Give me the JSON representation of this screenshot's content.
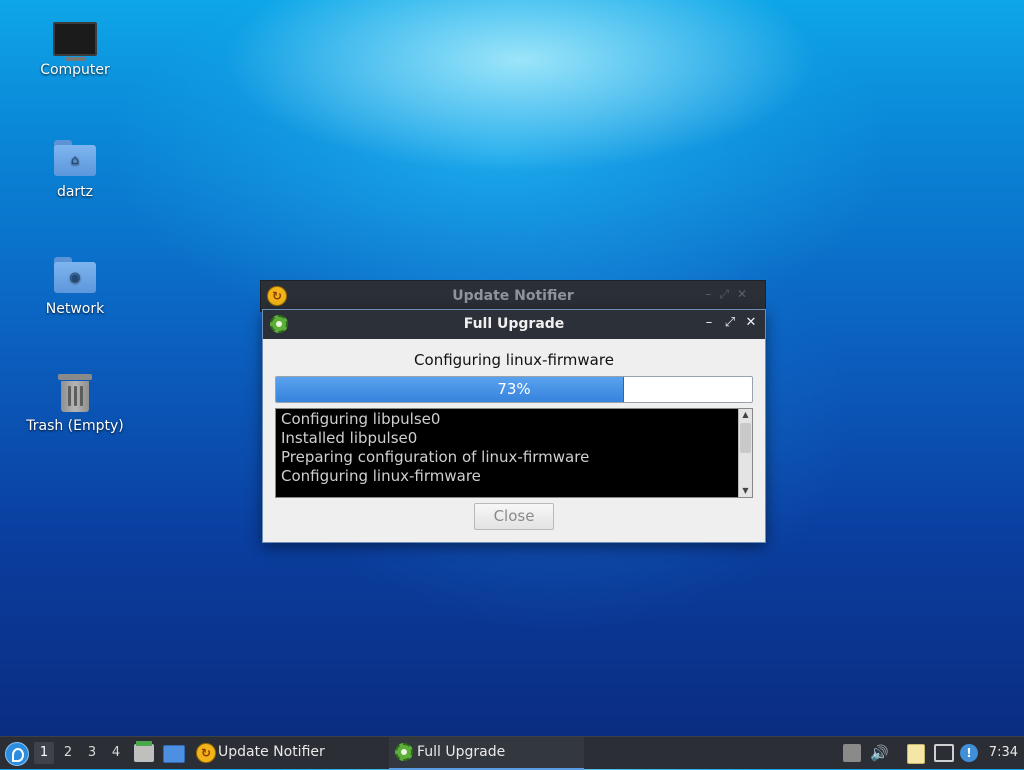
{
  "desktop": {
    "icons": [
      {
        "label": "Computer"
      },
      {
        "label": "dartz"
      },
      {
        "label": "Network"
      },
      {
        "label": "Trash (Empty)"
      }
    ]
  },
  "background_window": {
    "title": "Update Notifier"
  },
  "dialog": {
    "title": "Full Upgrade",
    "status": "Configuring linux-firmware",
    "progress": {
      "percent": 73,
      "label": "73%"
    },
    "log_lines": [
      "Configuring libpulse0",
      "Installed libpulse0",
      "Preparing configuration of linux-firmware",
      "Configuring linux-firmware"
    ],
    "close_label": "Close"
  },
  "taskbar": {
    "workspaces": [
      "1",
      "2",
      "3",
      "4"
    ],
    "active_workspace": "1",
    "tasks": [
      {
        "label": "Update Notifier",
        "icon": "update-notifier-icon"
      },
      {
        "label": "Full Upgrade",
        "icon": "gear-icon",
        "active": true
      }
    ],
    "clock": "7:34"
  },
  "colors": {
    "progress_fill": "#3783dc",
    "titlebar": "#2c3038",
    "taskbar": "#2b2e34"
  }
}
